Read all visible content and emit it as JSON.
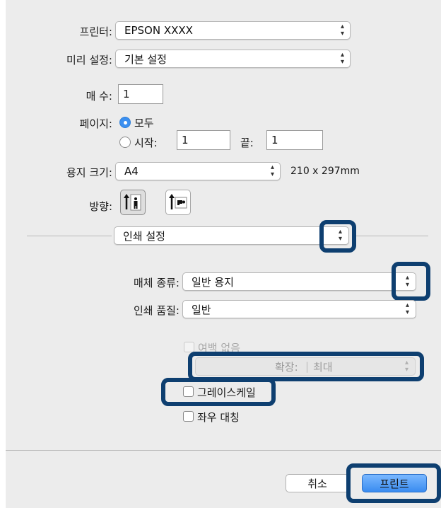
{
  "printer": {
    "label": "프린터:",
    "value": "EPSON XXXX"
  },
  "presets": {
    "label": "미리 설정:",
    "value": "기본 설정"
  },
  "copies": {
    "label": "매 수:",
    "value": "1"
  },
  "pages": {
    "label": "페이지:",
    "all_label": "모두",
    "from_label": "시작:",
    "from_value": "1",
    "to_label": "끝:",
    "to_value": "1",
    "selected": "all"
  },
  "paper_size": {
    "label": "용지 크기:",
    "value": "A4",
    "dimensions": "210 x 297mm"
  },
  "orientation": {
    "label": "방향:",
    "selected": "portrait"
  },
  "section": {
    "value": "인쇄 설정"
  },
  "media_type": {
    "label": "매체 종류:",
    "value": "일반 용지"
  },
  "print_quality": {
    "label": "인쇄 품질:",
    "value": "일반"
  },
  "borderless": {
    "label": "여백 없음",
    "enabled": false
  },
  "expansion": {
    "label": "확장:",
    "value": "최대",
    "enabled": false
  },
  "grayscale": {
    "label": "그레이스케일",
    "checked": false
  },
  "mirror": {
    "label": "좌우 대칭",
    "checked": false
  },
  "buttons": {
    "cancel": "취소",
    "print": "프린트"
  },
  "colors": {
    "highlight": "#0e3f70",
    "accent": "#3b8ff0",
    "panel": "#ececec"
  }
}
